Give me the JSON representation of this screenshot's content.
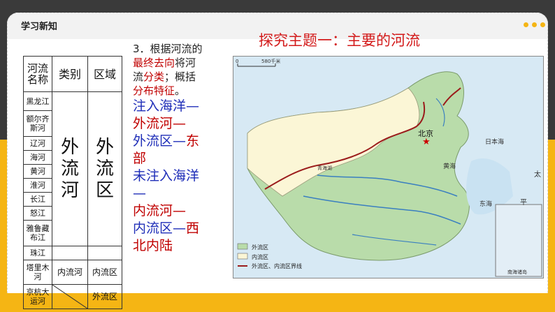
{
  "header": {
    "title": "学习新知"
  },
  "table": {
    "col_headers": [
      "河流名称",
      "类别",
      "区域"
    ],
    "rivers": [
      "黑龙江",
      "额尔齐斯河",
      "辽河",
      "海河",
      "黄河",
      "淮河",
      "长江",
      "怒江",
      "雅鲁藏布江",
      "珠江",
      "塔里木河",
      "京杭大运河"
    ],
    "category_outflow": [
      "外",
      "流",
      "河"
    ],
    "region_outflow": [
      "外",
      "流",
      "区"
    ],
    "category_inland": "内流河",
    "region_inland": "内流区",
    "region_canal": "外流区"
  },
  "task": {
    "line1": "3．根据河流的",
    "line2_red": "最终去向",
    "line2_black": "将河",
    "line3_black1": "流",
    "line3_red": "分类",
    "line3_black2": "；概括",
    "line4_red": "分布特征",
    "line4_black": "。",
    "p1": "注入海洋—",
    "p2": "外流河—",
    "p3a": "外流区—",
    "p3b": "东",
    "p4": "部",
    "p5": "未注入海洋",
    "p6": "—",
    "p7": "内流河—",
    "p8a": "内流区—",
    "p8b": "西",
    "p9": "北内陆"
  },
  "topic": {
    "title": "探究主题一：主要的河流"
  },
  "map": {
    "scale_zero": "0",
    "scale_label": "580千米",
    "capital": "北京",
    "labels": {
      "yellow_sea": "黄海",
      "east_sea": "东海",
      "japan_sea": "日本海",
      "pacific1": "太",
      "pacific2": "平",
      "qinghai": "青海湖",
      "south_sea_islands": "南海诸岛"
    },
    "legend": [
      {
        "label": "外流区",
        "color": "#b9dcaa"
      },
      {
        "label": "内流区",
        "color": "#fbf6d6"
      },
      {
        "label": "外流区、内流区界线",
        "color": "#9b1c1c"
      }
    ]
  }
}
